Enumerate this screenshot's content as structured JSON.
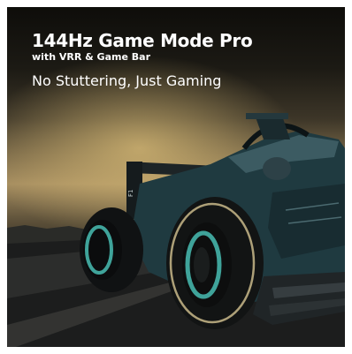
{
  "banner": {
    "headline": "144Hz Game Mode Pro",
    "subline": "with VRR & Game Bar",
    "tagline": "No Stuttering, Just Gaming"
  },
  "colors": {
    "text": "#ffffff",
    "sky_glow": "#c8a86a",
    "car_body": "#1f3a40",
    "tire_rim": "#3fa39a",
    "tire_stripe": "#c9b98a"
  },
  "icons": {
    "hero_image": "formula-race-car"
  }
}
